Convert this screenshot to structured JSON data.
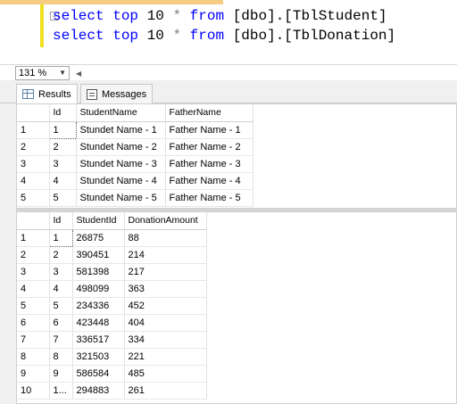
{
  "editor": {
    "lines": [
      {
        "kw1": "select",
        "kw2": "top",
        "num": "10",
        "star": "*",
        "kw3": "from",
        "target": "[dbo].[TblStudent]"
      },
      {
        "kw1": "select",
        "kw2": "top",
        "num": "10",
        "star": "*",
        "kw3": "from",
        "target": "[dbo].[TblDonation]"
      }
    ]
  },
  "zoom": {
    "value": "131 %"
  },
  "tabs": {
    "results": "Results",
    "messages": "Messages"
  },
  "grid1": {
    "columns": [
      "",
      "Id",
      "StudentName",
      "FatherName"
    ],
    "rows": [
      [
        "1",
        "1",
        "Stundet Name - 1",
        "Father Name - 1"
      ],
      [
        "2",
        "2",
        "Stundet Name - 2",
        "Father Name - 2"
      ],
      [
        "3",
        "3",
        "Stundet Name - 3",
        "Father Name - 3"
      ],
      [
        "4",
        "4",
        "Stundet Name - 4",
        "Father Name - 4"
      ],
      [
        "5",
        "5",
        "Stundet Name - 5",
        "Father Name - 5"
      ]
    ]
  },
  "grid2": {
    "columns": [
      "",
      "Id",
      "StudentId",
      "DonationAmount"
    ],
    "rows": [
      [
        "1",
        "1",
        "26875",
        "88"
      ],
      [
        "2",
        "2",
        "390451",
        "214"
      ],
      [
        "3",
        "3",
        "581398",
        "217"
      ],
      [
        "4",
        "4",
        "498099",
        "363"
      ],
      [
        "5",
        "5",
        "234336",
        "452"
      ],
      [
        "6",
        "6",
        "423448",
        "404"
      ],
      [
        "7",
        "7",
        "336517",
        "334"
      ],
      [
        "8",
        "8",
        "321503",
        "221"
      ],
      [
        "9",
        "9",
        "586584",
        "485"
      ],
      [
        "10",
        "1...",
        "294883",
        "261"
      ]
    ]
  }
}
